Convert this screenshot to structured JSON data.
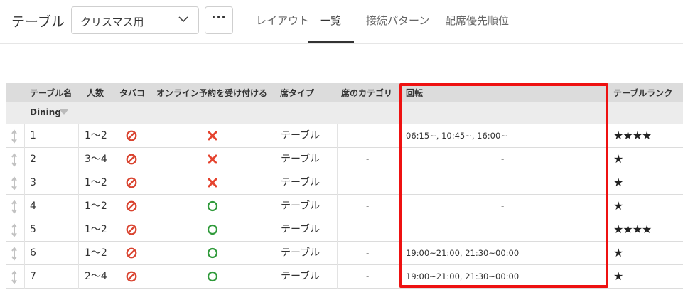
{
  "header": {
    "title": "テーブル",
    "selected_layout": "クリスマス用",
    "more_label": "···",
    "tabs": [
      {
        "label": "レイアウト",
        "active": false
      },
      {
        "label": "一覧",
        "active": true
      },
      {
        "label": "接続パターン",
        "active": false
      },
      {
        "label": "配席優先順位",
        "active": false
      }
    ]
  },
  "table": {
    "columns": [
      "テーブル名",
      "人数",
      "タバコ",
      "オンライン予約を受け付ける",
      "席タイプ",
      "席のカテゴリ",
      "回転",
      "テーブルランク"
    ],
    "group": "Dining",
    "rows": [
      {
        "name": "1",
        "people": "1～2",
        "tobacco": "no-smoking",
        "online": "cross",
        "type": "テーブル",
        "category": "-",
        "rotation": "06:15~, 10:45~, 16:00~",
        "rank": "★★★★"
      },
      {
        "name": "2",
        "people": "3～4",
        "tobacco": "no-smoking",
        "online": "cross",
        "type": "テーブル",
        "category": "-",
        "rotation": "-",
        "rank": "★"
      },
      {
        "name": "3",
        "people": "1～2",
        "tobacco": "no-smoking",
        "online": "cross",
        "type": "テーブル",
        "category": "-",
        "rotation": "-",
        "rank": "★"
      },
      {
        "name": "4",
        "people": "1～2",
        "tobacco": "no-smoking",
        "online": "circle",
        "type": "テーブル",
        "category": "-",
        "rotation": "-",
        "rank": "★"
      },
      {
        "name": "5",
        "people": "1～2",
        "tobacco": "no-smoking",
        "online": "circle",
        "type": "テーブル",
        "category": "-",
        "rotation": "-",
        "rank": "★★★★"
      },
      {
        "name": "6",
        "people": "1～2",
        "tobacco": "no-smoking",
        "online": "circle",
        "type": "テーブル",
        "category": "-",
        "rotation": "19:00~21:00, 21:30~00:00",
        "rank": "★"
      },
      {
        "name": "7",
        "people": "2～4",
        "tobacco": "no-smoking",
        "online": "circle",
        "type": "テーブル",
        "category": "-",
        "rotation": "19:00~21:00, 21:30~00:00",
        "rank": "★"
      }
    ]
  },
  "colors": {
    "highlight": "#ee1111",
    "no_smoking": "#d9432f",
    "cross": "#e5442f",
    "circle": "#2f9a3a"
  }
}
